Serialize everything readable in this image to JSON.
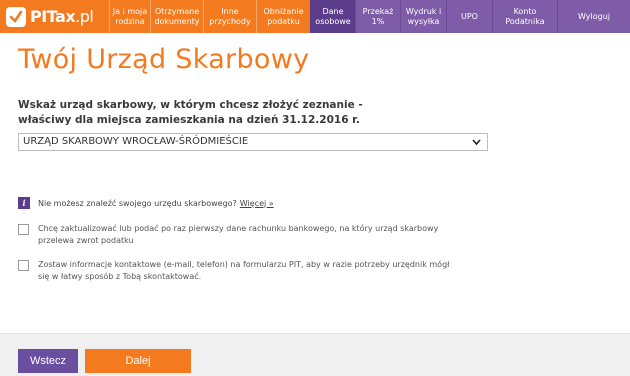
{
  "colors": {
    "accent": "#f47a20",
    "purple": "#5b3d8c",
    "purple_light": "#7e5ca8"
  },
  "nav": {
    "logo": {
      "text_bold": "PITax",
      "text_thin": ".pl",
      "icon": "checkmark-icon"
    },
    "items": [
      {
        "label": "Ja i moja rodzina",
        "width": 41,
        "state": "normal"
      },
      {
        "label": "Otrzymane dokumenty",
        "width": 53,
        "state": "normal"
      },
      {
        "label": "Inne przychody",
        "width": 53,
        "state": "normal"
      },
      {
        "label": "Obniżanie podatku",
        "width": 54,
        "state": "normal"
      },
      {
        "label": "Dane osobowe",
        "width": 45,
        "state": "active"
      },
      {
        "label": "Przekaż 1%",
        "width": 45,
        "state": "purple"
      },
      {
        "label": "Wydruk i wysyłka",
        "width": 46,
        "state": "purple"
      },
      {
        "label": "UPO",
        "width": 46,
        "state": "purple"
      },
      {
        "label": "Konto Podatnika",
        "width": 65,
        "state": "purple"
      },
      {
        "label": "Wyloguj",
        "width": 73,
        "state": "purple"
      }
    ]
  },
  "page": {
    "title": "Twój Urząd Skarbowy",
    "question_line1": "Wskaż urząd skarbowy, w którym chcesz złożyć zeznanie -",
    "question_line2": "właściwy dla miejsca zamieszkania na dzień 31.12.2016 r.",
    "selected_office": "URZĄD SKARBOWY WROCŁAW-ŚRÓDMIEŚCIE",
    "info_text": "Nie możesz znaleźć swojego urzędu skarbowego?",
    "info_link": "Więcej »",
    "checkbox_1": "Chcę zaktualizować lub podać po raz pierwszy dane rachunku bankowego, na który urząd skarbowy przelewa zwrot podatku",
    "checkbox_2": "Zostaw informacje kontaktowe (e-mail, telefon) na formularzu PIT, aby w razie potrzeby urzędnik mógł się w łatwy sposób z Tobą skontaktować."
  },
  "footer": {
    "back_label": "Wstecz",
    "next_label": "Dalej"
  }
}
